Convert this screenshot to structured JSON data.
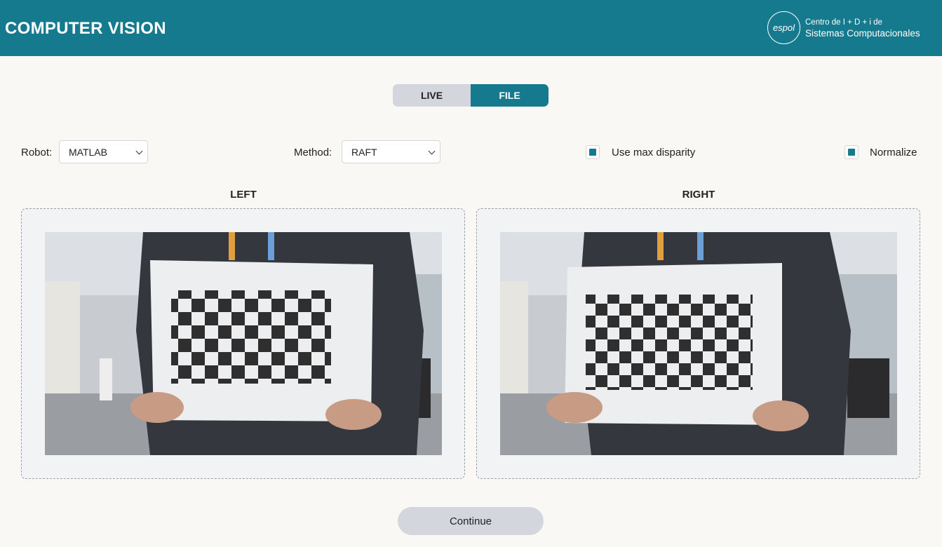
{
  "header": {
    "title": "COMPUTER VISION",
    "logo_mark": "espol",
    "logo_line1": "Centro de I + D + i de",
    "logo_line2": "Sistemas Computacionales"
  },
  "mode_toggle": {
    "options": [
      "LIVE",
      "FILE"
    ],
    "selected": "FILE"
  },
  "controls": {
    "robot_label": "Robot:",
    "robot_value": "MATLAB",
    "method_label": "Method:",
    "method_value": "RAFT",
    "max_disparity_label": "Use max disparity",
    "max_disparity_checked": true,
    "normalize_label": "Normalize",
    "normalize_checked": true
  },
  "panels": {
    "left_title": "LEFT",
    "right_title": "RIGHT"
  },
  "continue_label": "Continue",
  "colors": {
    "accent": "#167a8e",
    "background": "#f9f8f4",
    "neutral_button": "#d3d6dd"
  }
}
